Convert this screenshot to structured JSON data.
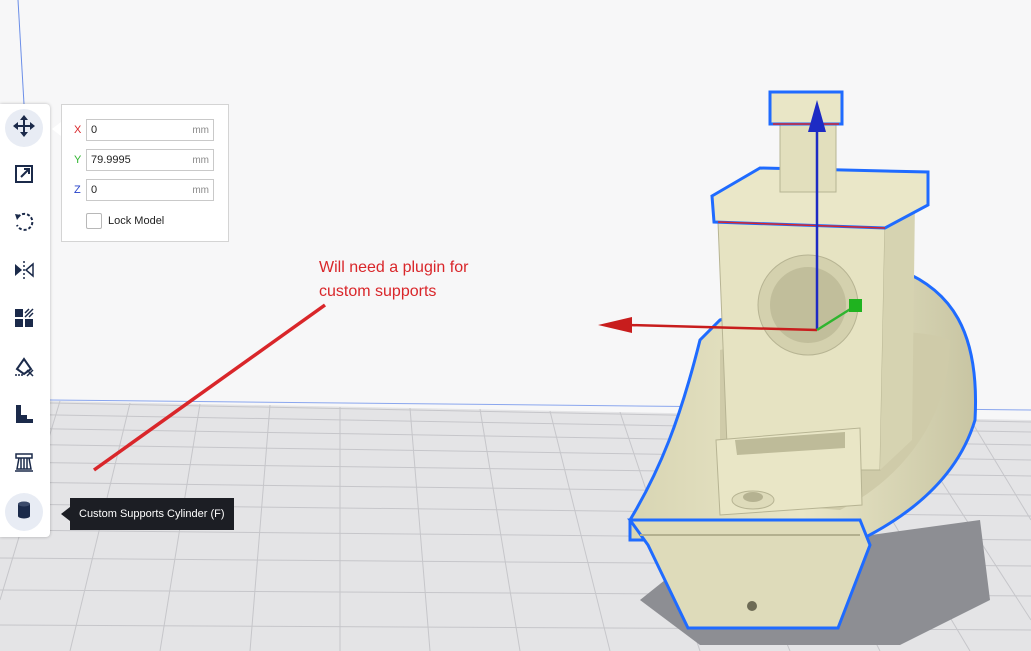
{
  "toolbar": {
    "tools": [
      {
        "name": "move-tool",
        "icon": "move-icon",
        "active": true
      },
      {
        "name": "scale-tool",
        "icon": "scale-icon"
      },
      {
        "name": "rotate-tool",
        "icon": "rotate-icon"
      },
      {
        "name": "mirror-tool",
        "icon": "mirror-icon"
      },
      {
        "name": "per-model-settings-tool",
        "icon": "per-model-settings-icon"
      },
      {
        "name": "support-blocker-tool",
        "icon": "support-blocker-icon"
      },
      {
        "name": "custom-supports-tool",
        "icon": "stairs-support-icon"
      },
      {
        "name": "support-tower-tool",
        "icon": "tower-support-icon"
      },
      {
        "name": "custom-supports-cylinder-tool",
        "icon": "cylinder-icon"
      }
    ]
  },
  "move_panel": {
    "x": {
      "label": "X",
      "value": "0",
      "unit": "mm",
      "color": "#d9262a"
    },
    "y": {
      "label": "Y",
      "value": "79.9995",
      "unit": "mm",
      "color": "#2fb52f"
    },
    "z": {
      "label": "Z",
      "value": "0",
      "unit": "mm",
      "color": "#2541c9"
    },
    "lock_model_label": "Lock Model",
    "lock_model_checked": false
  },
  "tooltip": {
    "text": "Custom Supports Cylinder (F)"
  },
  "annotation": {
    "line1": "Will need a plugin for",
    "line2": "custom supports",
    "color": "#d9262a"
  },
  "colors": {
    "accent": "#2541c9",
    "model": "#e8e5c4",
    "selection_outline": "#1f6bff"
  }
}
